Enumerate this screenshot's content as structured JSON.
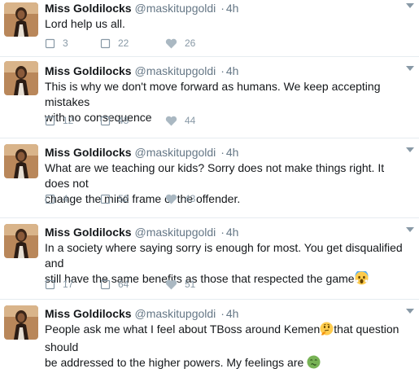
{
  "tweets": [
    {
      "name": "Miss Goldilocks",
      "handle": "@maskitupgoldi",
      "separator": "·",
      "time": "4h",
      "lines": [
        "Lord help us all."
      ],
      "replies": "3",
      "retweets": "22",
      "likes": "26"
    },
    {
      "name": "Miss Goldilocks",
      "handle": "@maskitupgoldi",
      "separator": "·",
      "time": "4h",
      "lines": [
        "This is why we don't move forward as humans. We keep accepting mistakes",
        "with no consequence"
      ],
      "replies": "12",
      "retweets": "45",
      "likes": "44"
    },
    {
      "name": "Miss Goldilocks",
      "handle": "@maskitupgoldi",
      "separator": "·",
      "time": "4h",
      "lines": [
        "What are we teaching our kids? Sorry does not make things right. It does not",
        "change the mind frame of the offender."
      ],
      "replies": "4",
      "retweets": "52",
      "likes": "43"
    },
    {
      "name": "Miss Goldilocks",
      "handle": "@maskitupgoldi",
      "separator": "·",
      "time": "4h",
      "lines": [
        "In a society where saying sorry is enough for most. You get disqualified and",
        "still have the same benefits as those that respected the game"
      ],
      "replies": "17",
      "retweets": "64",
      "likes": "51"
    },
    {
      "name": "Miss Goldilocks",
      "handle": "@maskitupgoldi",
      "separator": "·",
      "time": "4h",
      "lines": [
        "People ask me what I feel about TBoss around Kemen",
        "that question should",
        "be addressed to the higher powers. My feelings are "
      ],
      "replies": "",
      "retweets": "",
      "likes": ""
    }
  ],
  "icons": {
    "reply": "reply-icon",
    "retweet": "retweet-icon",
    "like": "heart-icon",
    "more": "chevron-down-icon",
    "emoji_scream": "face-screaming-emoji",
    "emoji_thinking": "thinking-face-emoji",
    "emoji_nauseated": "nauseated-face-emoji"
  },
  "colors": {
    "name": "#14171a",
    "secondary": "#657786",
    "action": "#8899a6",
    "divider": "#e6ecf0"
  }
}
